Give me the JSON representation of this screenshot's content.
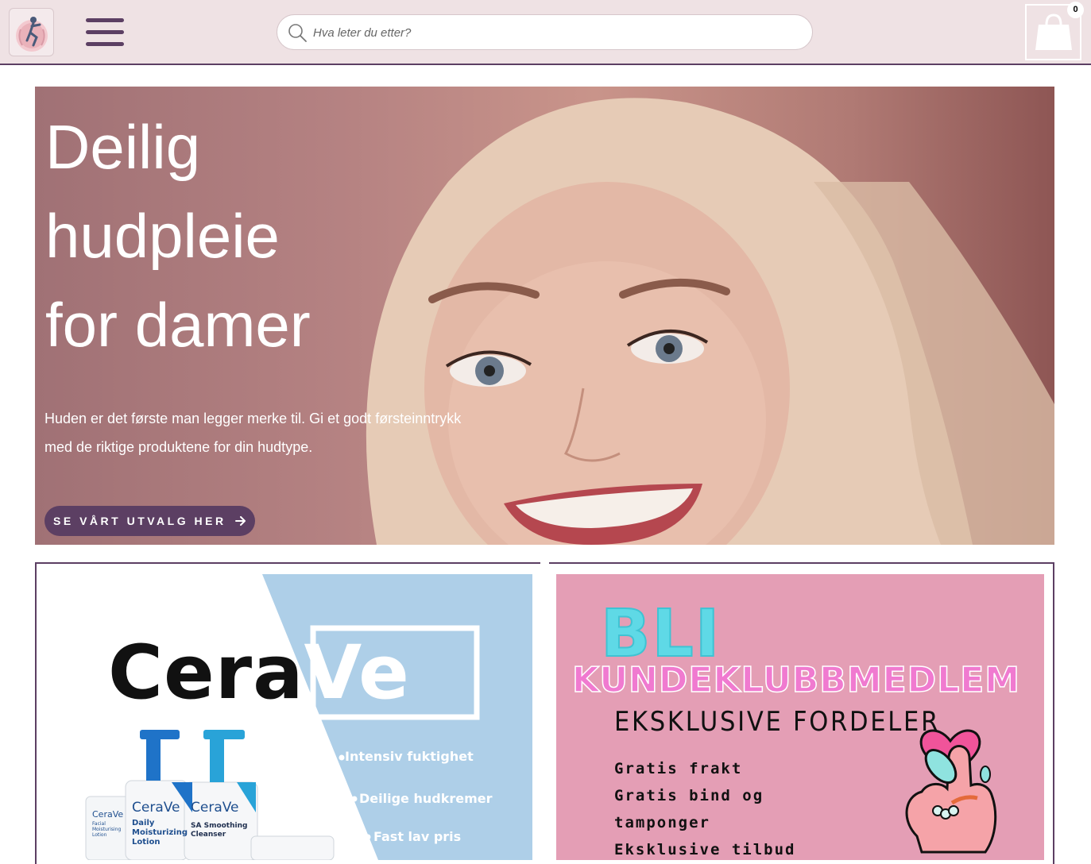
{
  "header": {
    "logo_name": "logo",
    "menu_icon": "hamburger-menu-icon",
    "search": {
      "placeholder": "Hva leter du etter?",
      "icon": "search-icon"
    },
    "cart": {
      "icon": "shopping-bag-icon",
      "count": "0"
    }
  },
  "hero": {
    "title_lines": [
      "Deilig",
      "hudpleie",
      "for damer"
    ],
    "text_line1": "Huden er det første man legger merke til. Gi et godt førsteinntrykk",
    "text_line2": "med de riktige produktene for din hudtype.",
    "button_label": "SE VÅRT UTVALG HER",
    "button_icon": "arrow-right-icon"
  },
  "promo_cerave": {
    "brand_part1": "Cera",
    "brand_part2": "Ve",
    "bullets": [
      "Intensiv fuktighet",
      "Deilige hudkremer",
      "Fast lav pris"
    ],
    "product_labels": [
      "CeraVe",
      "CeraVe",
      "CeraVe"
    ],
    "product_names": [
      "Facial Moisturising Lotion",
      "Daily Moisturizing Lotion",
      "SA Smoothing Cleanser"
    ]
  },
  "promo_club": {
    "line1": "BLI",
    "line2": "KUNDEKLUBBMEDLEM",
    "heading": "EKSKLUSIVE FORDELER",
    "benefits": [
      "Gratis frakt",
      "Gratis bind og",
      "tamponger",
      "Eksklusive tilbud"
    ]
  },
  "colors": {
    "header_bg": "#efe2e4",
    "brand_purple": "#5c3f63",
    "club_pink": "#e49eb5",
    "cerave_blue": "#aecfe8"
  }
}
